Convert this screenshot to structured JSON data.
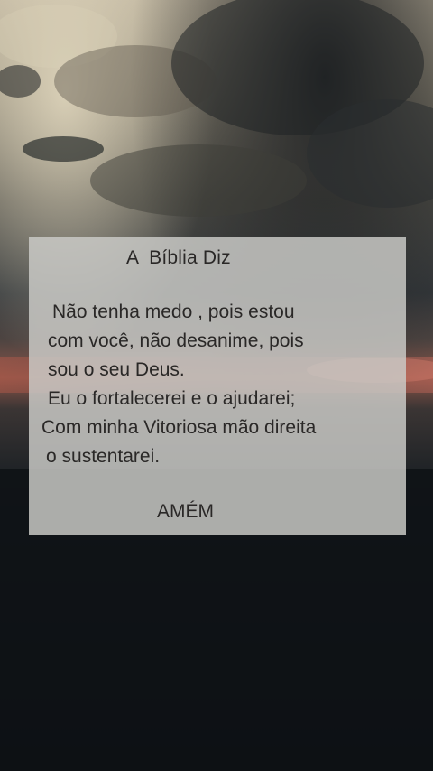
{
  "card": {
    "title": "A  Bíblia Diz",
    "verse_lines": [
      "Não tenha medo , pois estou",
      "com você, não desanime, pois",
      "sou o seu Deus.",
      "Eu o fortalecerei e o ajudarei;",
      "Com minha Vitoriosa mão direita",
      "o sustentarei."
    ],
    "closing": "AMÉM"
  },
  "colors": {
    "card_background": "#cbcac7",
    "text": "#2a2827",
    "sky_light": "#c8bda5",
    "sky_dark": "#23272b",
    "horizon_glow": "#a5584a",
    "ground": "#0d1115"
  }
}
